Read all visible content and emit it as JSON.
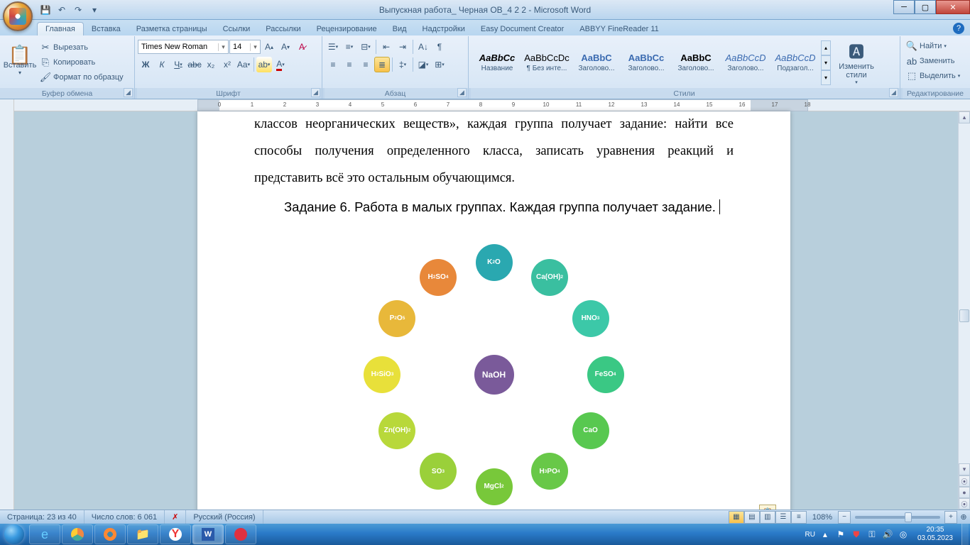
{
  "window": {
    "title": "Выпускная работа_ Черная ОВ_4 2 2 - Microsoft Word"
  },
  "qat": {
    "save": "💾",
    "undo": "↶",
    "redo": "↷",
    "more": "▾"
  },
  "tabs": [
    "Главная",
    "Вставка",
    "Разметка страницы",
    "Ссылки",
    "Рассылки",
    "Рецензирование",
    "Вид",
    "Надстройки",
    "Easy Document Creator",
    "ABBYY FineReader 11"
  ],
  "active_tab": 0,
  "ribbon": {
    "clipboard": {
      "title": "Буфер обмена",
      "paste": "Вставить",
      "cut": "Вырезать",
      "copy": "Копировать",
      "painter": "Формат по образцу"
    },
    "font": {
      "title": "Шрифт",
      "family": "Times New Roman",
      "size": "14"
    },
    "paragraph": {
      "title": "Абзац"
    },
    "styles": {
      "title": "Стили",
      "items": [
        {
          "preview": "AaBbCc",
          "name": "Название",
          "bold": true,
          "italic": true
        },
        {
          "preview": "AaBbCcDc",
          "name": "¶ Без инте..."
        },
        {
          "preview": "AaBbC",
          "name": "Заголово...",
          "color": "#3a6ab0",
          "bold": true
        },
        {
          "preview": "AaBbCc",
          "name": "Заголово...",
          "color": "#3a6ab0",
          "bold": true
        },
        {
          "preview": "AaBbC",
          "name": "Заголово...",
          "bold": true
        },
        {
          "preview": "AaBbCcD",
          "name": "Заголово...",
          "color": "#3a6ab0",
          "italic": true
        },
        {
          "preview": "AaBbCcD",
          "name": "Подзагол...",
          "color": "#3a6ab0",
          "italic": true
        }
      ],
      "change": "Изменить стили"
    },
    "editing": {
      "title": "Редактирование",
      "find": "Найти",
      "replace": "Заменить",
      "select": "Выделить"
    }
  },
  "document": {
    "p1": "классов неорганических веществ», каждая группа получает задание: найти все способы получения определенного класса, записать уравнения реакций и представить всё это остальным обучающимся.",
    "p2": "Задание 6. Работа в малых группах. Каждая группа получает задание."
  },
  "chart_data": {
    "type": "radial-diagram",
    "center": {
      "label": "NaOH",
      "color": "#7a5a9a"
    },
    "nodes": [
      {
        "label": "K₂O",
        "color": "#2aa8b0",
        "angle": -90
      },
      {
        "label": "Ca(OH)₂",
        "color": "#3abfa0",
        "angle": -60
      },
      {
        "label": "HNO₃",
        "color": "#3cc8a8",
        "angle": -30
      },
      {
        "label": "FeSO₄",
        "color": "#3ac884",
        "angle": 0
      },
      {
        "label": "CaO",
        "color": "#58c850",
        "angle": 30
      },
      {
        "label": "H₃PO₄",
        "color": "#68c848",
        "angle": 60
      },
      {
        "label": "MgCl₂",
        "color": "#78c83a",
        "angle": 90
      },
      {
        "label": "SO₃",
        "color": "#9ad03a",
        "angle": 120
      },
      {
        "label": "Zn(OH)₂",
        "color": "#b8d83a",
        "angle": 150
      },
      {
        "label": "H₂SiO₃",
        "color": "#e8e03a",
        "angle": 180
      },
      {
        "label": "P₂O₅",
        "color": "#e8b83a",
        "angle": 210
      },
      {
        "label": "H₂SO₄",
        "color": "#e8883a",
        "angle": 240
      }
    ],
    "radius": 155,
    "spoke_color": "#e8943a"
  },
  "status": {
    "page": "Страница: 23 из 40",
    "words": "Число слов: 6 061",
    "lang": "Русский (Россия)",
    "zoom": "108%"
  },
  "taskbar": {
    "lang": "RU",
    "time": "20:35",
    "date": "03.05.2023"
  }
}
